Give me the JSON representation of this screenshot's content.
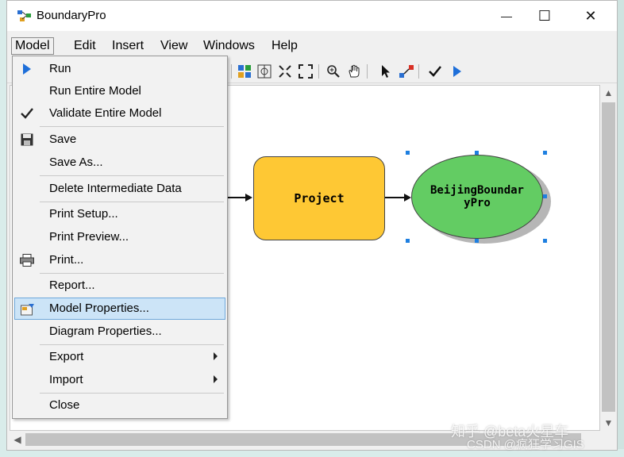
{
  "window": {
    "title": "BoundaryPro",
    "controls": {
      "minimize": "—",
      "maximize": "☐",
      "close": "✕"
    }
  },
  "menubar": {
    "items": [
      {
        "label": "Model",
        "active": true
      },
      {
        "label": "Edit"
      },
      {
        "label": "Insert"
      },
      {
        "label": "View"
      },
      {
        "label": "Windows"
      },
      {
        "label": "Help"
      }
    ]
  },
  "toolbar": {
    "icons": [
      "full-extent-icon",
      "fixed-zoom-icon",
      "zoom-in-out-icon",
      "fit-window-icon",
      "zoom-in-icon",
      "pan-icon",
      "select-icon",
      "connect-icon",
      "validate-icon",
      "run-icon"
    ]
  },
  "model_menu": {
    "items": [
      {
        "label": "Run",
        "icon": "run-icon"
      },
      {
        "label": "Run Entire Model"
      },
      {
        "label": "Validate Entire Model",
        "icon": "check-icon"
      },
      {
        "label": "Save",
        "icon": "save-icon"
      },
      {
        "label": "Save As..."
      },
      {
        "label": "Delete Intermediate Data"
      },
      {
        "label": "Print Setup..."
      },
      {
        "label": "Print Preview..."
      },
      {
        "label": "Print...",
        "icon": "printer-icon"
      },
      {
        "label": "Report..."
      },
      {
        "label": "Model Properties...",
        "icon": "properties-icon",
        "highlighted": true
      },
      {
        "label": "Diagram Properties..."
      },
      {
        "label": "Export",
        "submenu": true
      },
      {
        "label": "Import",
        "submenu": true
      },
      {
        "label": "Close"
      }
    ]
  },
  "diagram": {
    "tool_label": "Project",
    "output_label": "BeijingBoundaryPro",
    "colors": {
      "tool": "#fec834",
      "output": "#63cc63",
      "selection": "#1e7fe0"
    }
  },
  "watermark": {
    "line1": "知乎 @beta火星车",
    "line2": "CSDN @疯狂学习GIS"
  }
}
